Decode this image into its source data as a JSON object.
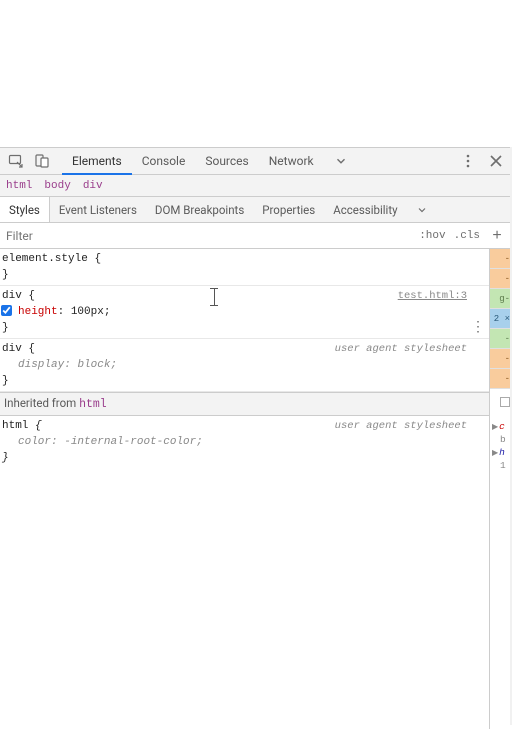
{
  "toolbar": {
    "tabs": [
      "Elements",
      "Console",
      "Sources",
      "Network"
    ],
    "active_tab_index": 0
  },
  "breadcrumb": [
    "html",
    "body",
    "div"
  ],
  "sub_tabs": {
    "items": [
      "Styles",
      "Event Listeners",
      "DOM Breakpoints",
      "Properties",
      "Accessibility"
    ],
    "active_index": 0
  },
  "filter": {
    "placeholder": "Filter",
    "hov_label": ":hov",
    "cls_label": ".cls"
  },
  "rules": {
    "element_style": {
      "selector": "element.style"
    },
    "rule1": {
      "selector": "div",
      "source": "test.html:3",
      "prop_name": "height",
      "prop_value": "100px"
    },
    "rule2": {
      "selector": "div",
      "source": "user agent stylesheet",
      "prop_name": "display",
      "prop_value": "block"
    },
    "inherited": {
      "prefix": "Inherited from",
      "element": "html"
    },
    "rule3": {
      "selector": "html",
      "source": "user agent stylesheet",
      "prop_name": "color",
      "prop_value": "-internal-root-color"
    }
  },
  "side": {
    "stripes": [
      {
        "class": "tan",
        "text": "-"
      },
      {
        "class": "tan",
        "text": "-"
      },
      {
        "class": "green",
        "text": "g-"
      },
      {
        "class": "blue",
        "text": "2 ×"
      },
      {
        "class": "green",
        "text": "-"
      },
      {
        "class": "tan",
        "text": "-"
      },
      {
        "class": "tan",
        "text": "-"
      }
    ],
    "lower": {
      "c_text": "c",
      "b_text": "b",
      "h_text": "h",
      "n_text": "1"
    }
  }
}
